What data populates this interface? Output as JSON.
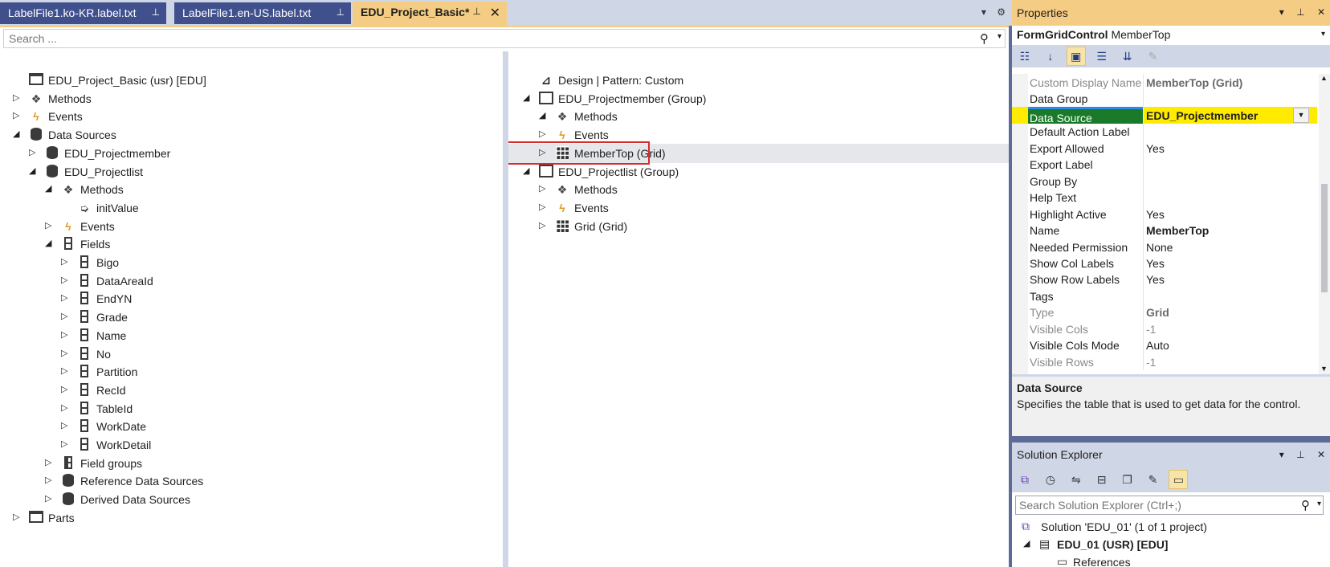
{
  "tabs": [
    {
      "label": "LabelFile1.ko-KR.label.txt"
    },
    {
      "label": "LabelFile1.en-US.label.txt"
    },
    {
      "label": "EDU_Project_Basic*"
    }
  ],
  "search": {
    "placeholder": "Search ..."
  },
  "left_tree": [
    {
      "label": "EDU_Project_Basic (usr) [EDU]",
      "icon": "form-icon"
    },
    {
      "label": "Methods",
      "icon": "methods-icon"
    },
    {
      "label": "Events",
      "icon": "events-icon"
    },
    {
      "label": "Data Sources",
      "icon": "database-icon"
    },
    {
      "label": "EDU_Projectmember",
      "icon": "database-icon"
    },
    {
      "label": "EDU_Projectlist",
      "icon": "database-icon"
    },
    {
      "label": "Methods",
      "icon": "methods-icon"
    },
    {
      "label": "initValue",
      "icon": "method-icon"
    },
    {
      "label": "Events",
      "icon": "events-icon"
    },
    {
      "label": "Fields",
      "icon": "field-icon"
    },
    {
      "label": "Bigo",
      "icon": "field-icon"
    },
    {
      "label": "DataAreaId",
      "icon": "field-icon"
    },
    {
      "label": "EndYN",
      "icon": "field-icon"
    },
    {
      "label": "Grade",
      "icon": "field-icon"
    },
    {
      "label": "Name",
      "icon": "field-icon"
    },
    {
      "label": "No",
      "icon": "field-icon"
    },
    {
      "label": "Partition",
      "icon": "field-icon"
    },
    {
      "label": "RecId",
      "icon": "field-icon"
    },
    {
      "label": "TableId",
      "icon": "field-icon"
    },
    {
      "label": "WorkDate",
      "icon": "field-icon"
    },
    {
      "label": "WorkDetail",
      "icon": "field-icon"
    },
    {
      "label": "Field groups",
      "icon": "field-group-icon"
    },
    {
      "label": "Reference Data Sources",
      "icon": "database-icon"
    },
    {
      "label": "Derived Data Sources",
      "icon": "database-icon"
    },
    {
      "label": "Parts",
      "icon": "form-icon"
    }
  ],
  "right_tree": [
    {
      "label": "Design | Pattern: Custom",
      "icon": "design-icon"
    },
    {
      "label": "EDU_Projectmember (Group)",
      "icon": "group-icon"
    },
    {
      "label": "Methods",
      "icon": "methods-icon"
    },
    {
      "label": "Events",
      "icon": "events-icon"
    },
    {
      "label": "MemberTop (Grid)",
      "icon": "grid-icon"
    },
    {
      "label": "EDU_Projectlist (Group)",
      "icon": "group-icon"
    },
    {
      "label": "Methods",
      "icon": "methods-icon"
    },
    {
      "label": "Events",
      "icon": "events-icon"
    },
    {
      "label": "Grid (Grid)",
      "icon": "grid-icon"
    }
  ],
  "properties": {
    "title": "Properties",
    "object_type": "FormGridControl",
    "object_name": "MemberTop",
    "rows": [
      {
        "name": "Custom Display Name",
        "value": "MemberTop (Grid)",
        "dim": true,
        "bold": true
      },
      {
        "name": "Data Group",
        "value": ""
      },
      {
        "name": "Data Source",
        "value": "EDU_Projectmember",
        "selected": true
      },
      {
        "name": "Default Action Label",
        "value": ""
      },
      {
        "name": "Export Allowed",
        "value": "Yes"
      },
      {
        "name": "Export Label",
        "value": ""
      },
      {
        "name": "Group By",
        "value": ""
      },
      {
        "name": "Help Text",
        "value": ""
      },
      {
        "name": "Highlight Active",
        "value": "Yes"
      },
      {
        "name": "Name",
        "value": "MemberTop",
        "bold": true
      },
      {
        "name": "Needed Permission",
        "value": "None"
      },
      {
        "name": "Show Col Labels",
        "value": "Yes"
      },
      {
        "name": "Show Row Labels",
        "value": "Yes"
      },
      {
        "name": "Tags",
        "value": ""
      },
      {
        "name": "Type",
        "value": "Grid",
        "dim": true,
        "bold": true
      },
      {
        "name": "Visible Cols",
        "value": "-1",
        "dim": true
      },
      {
        "name": "Visible Cols Mode",
        "value": "Auto"
      },
      {
        "name": "Visible Rows",
        "value": "-1",
        "dim": true
      }
    ],
    "description_title": "Data Source",
    "description_text": "Specifies the table that is used to get data for the control."
  },
  "solution_explorer": {
    "title": "Solution Explorer",
    "search_placeholder": "Search Solution Explorer (Ctrl+;)",
    "items": [
      {
        "label": "Solution 'EDU_01' (1 of 1 project)"
      },
      {
        "label": "EDU_01 (USR) [EDU]"
      },
      {
        "label": "References"
      }
    ]
  },
  "colors": {
    "accent_tab": "#f5cc84",
    "inactive_tab": "#40508d",
    "selection_box": "#d62d2d",
    "highlight_yellow": "#ffeb00",
    "highlight_green": "#1a7a2a"
  }
}
